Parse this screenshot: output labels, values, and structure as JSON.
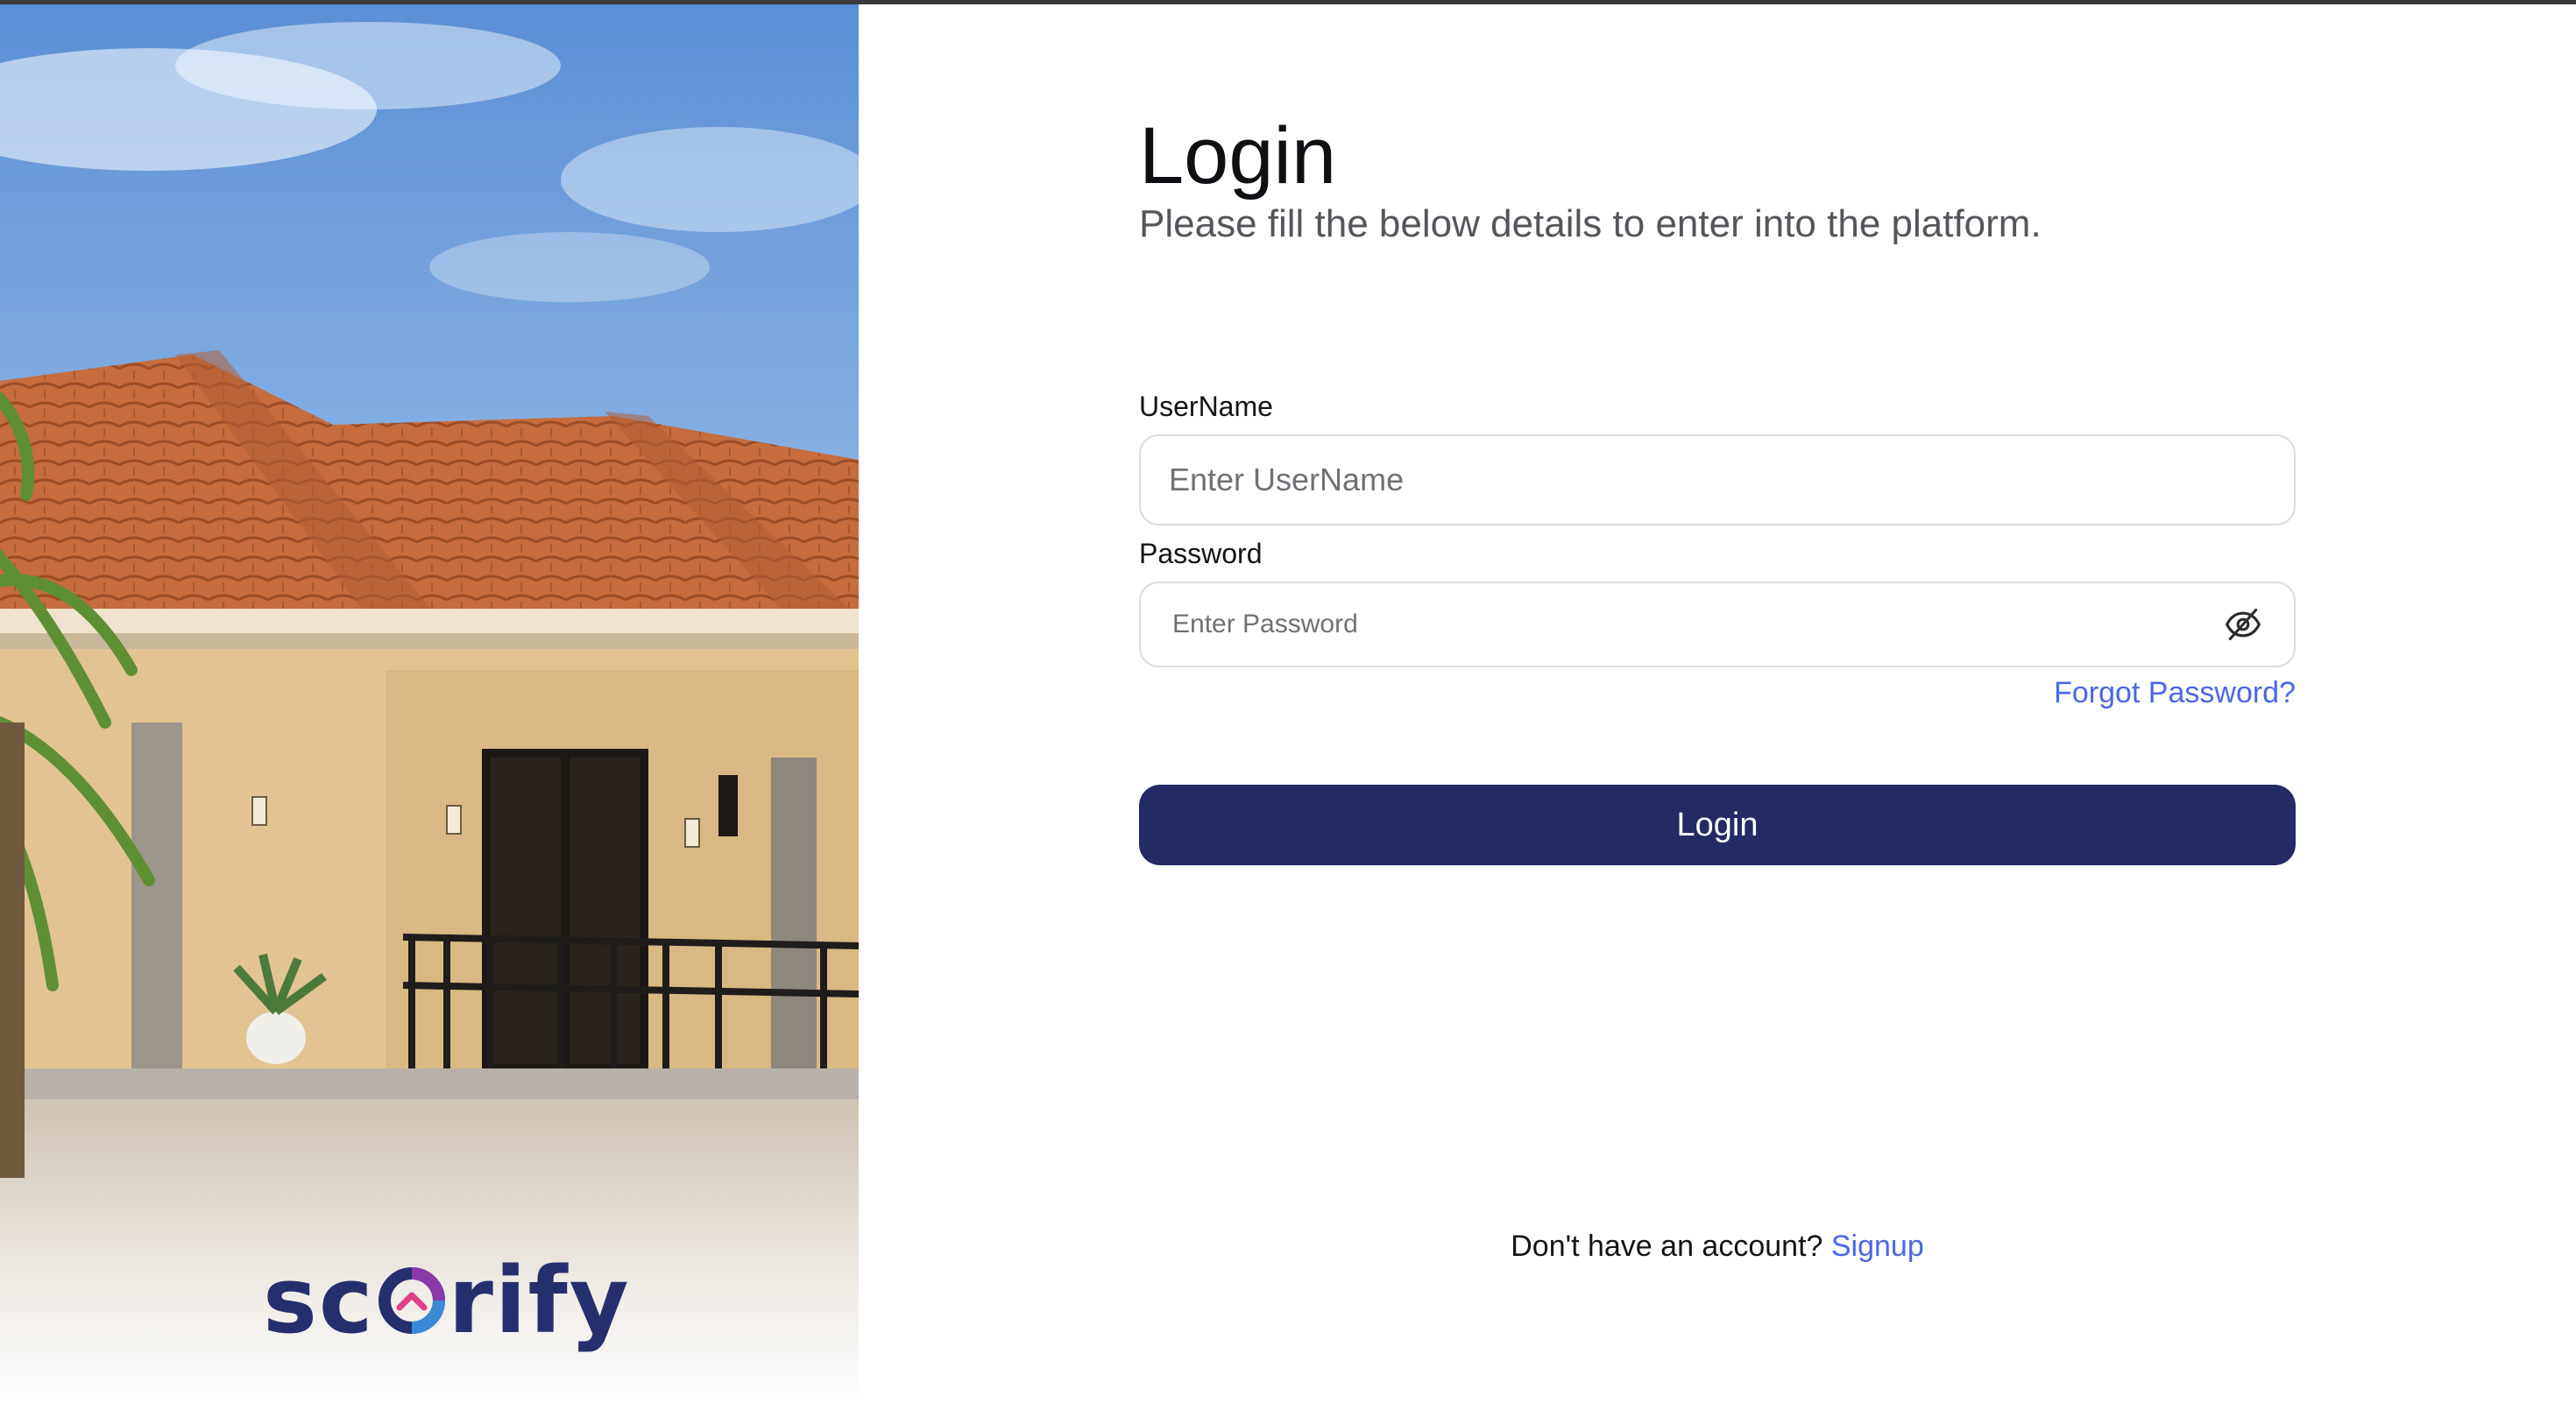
{
  "brand": {
    "logo_text_before": "sc",
    "logo_text_after": "rify",
    "logo_color": "#262f6e"
  },
  "hero": {
    "image": "house-photo"
  },
  "login": {
    "title": "Login",
    "subtitle": "Please fill the below details to enter into the platform.",
    "username": {
      "label": "UserName",
      "placeholder": "Enter UserName",
      "value": ""
    },
    "password": {
      "label": "Password",
      "placeholder": "Enter Password",
      "value": "",
      "toggle_icon": "eye-off-icon"
    },
    "forgot_password": "Forgot Password?",
    "submit_label": "Login"
  },
  "signup": {
    "prompt": "Don't have an account?",
    "link": "Signup"
  },
  "colors": {
    "primary": "#232a65",
    "link": "#4a67e6",
    "input_border": "#d9dbe0"
  }
}
